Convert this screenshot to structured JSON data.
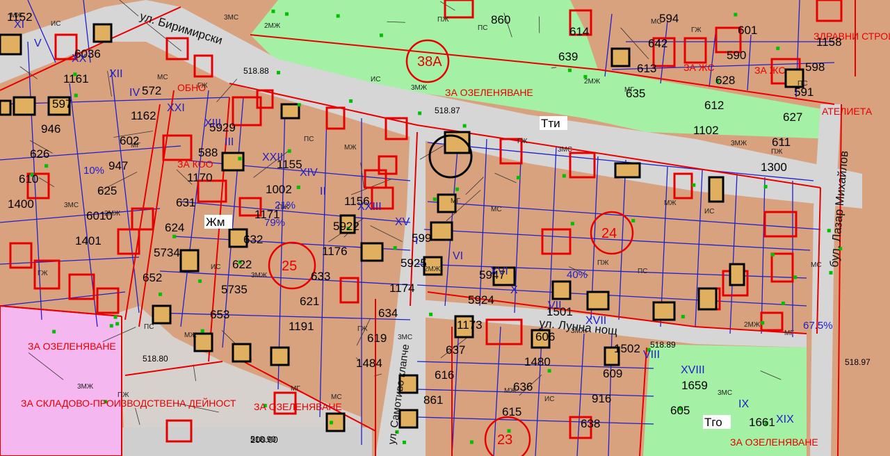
{
  "map": {
    "colors": {
      "parcel": "#d9a27e",
      "street": "#d6d6d6",
      "green": "#a4f0a4",
      "pink": "#f5b7f0",
      "regulation_line": "#e60000",
      "cadastre_line": "#2020c8",
      "building": "#000000",
      "green_marker": "#00c000"
    },
    "streets": [
      {
        "name": "ул. Биримирски"
      },
      {
        "name": "ул. Лунна нощ"
      },
      {
        "name": "ул. Самотиво клапче"
      },
      {
        "name": "бул. Лазар Михайлов"
      }
    ],
    "zone_labels": [
      {
        "text": "Тти"
      },
      {
        "text": "Жм"
      },
      {
        "text": "Тго"
      }
    ],
    "elevations": [
      "518.88",
      "518.87",
      "518.80",
      "518.89",
      "518.97",
      "518.90"
    ],
    "green_labels": [
      {
        "text": "ЗА ОЗЕЛЕНЯВАНЕ"
      },
      {
        "text": "ЗА ОЗЕЛЕНЯВАНЕ"
      },
      {
        "text": "ЗА ОЗЕЛЕНЯВАНЕ"
      },
      {
        "text": "ЗА ОЗЕЛЕНЯВАНЕ"
      }
    ],
    "red_notes": [
      {
        "text": "ЗА ЖС"
      },
      {
        "text": "ЗА ЖС"
      },
      {
        "text": "АТЕЛИЕТА"
      },
      {
        "text": "ЗА СКЛАДОВО-ПРОИЗВОДСТВЕНА ДЕЙНОСТ"
      },
      {
        "text": "ЗА КОО"
      },
      {
        "text": "ЗДРАВНИ СТРОИТЕЛСТВО"
      },
      {
        "text": "ОБНО"
      }
    ],
    "circled_quarters": [
      {
        "text": "38А"
      },
      {
        "text": "25"
      },
      {
        "text": "24"
      },
      {
        "text": "23"
      }
    ],
    "lot_numbers": [
      "1152",
      "6036",
      "572",
      "5929",
      "1155",
      "1156",
      "599",
      "5947",
      "1501",
      "1502",
      "1659",
      "1661",
      "1158",
      "1161",
      "1162",
      "588",
      "1002",
      "5922",
      "5925",
      "5924",
      "606",
      "609",
      "605",
      "601",
      "598",
      "597",
      "602",
      "1170",
      "1171",
      "1176",
      "1174",
      "1173",
      "1480",
      "916",
      "594",
      "590",
      "591",
      "946",
      "947",
      "631",
      "632",
      "633",
      "634",
      "637",
      "636",
      "638",
      "642",
      "628",
      "627",
      "626",
      "625",
      "624",
      "622",
      "621",
      "619",
      "616",
      "615",
      "614",
      "613",
      "612",
      "611",
      "610",
      "6010",
      "5734",
      "5735",
      "1191",
      "1484",
      "861",
      "860",
      "639",
      "635",
      "1102",
      "1300",
      "1400",
      "1401",
      "652",
      "653"
    ],
    "roman_numerals": [
      "XI",
      "XII",
      "XIII",
      "XIV",
      "XV",
      "XVI",
      "XVII",
      "XVIII",
      "XIX",
      "XX",
      "XXI",
      "XXII",
      "XXIII",
      "VI",
      "VII",
      "VIII",
      "IX",
      "V",
      "IV",
      "III",
      "II",
      "I",
      "X"
    ],
    "small_blue": [
      "МЖ",
      "МС",
      "ПС",
      "МГ",
      "ПЖ",
      "2МЖ",
      "3МЖ",
      "3МС",
      "ИС",
      "ГЖ"
    ],
    "percent_labels": [
      "67.5%",
      "79%",
      "21%",
      "40%",
      "10%"
    ],
    "scale_label": "200.00"
  }
}
